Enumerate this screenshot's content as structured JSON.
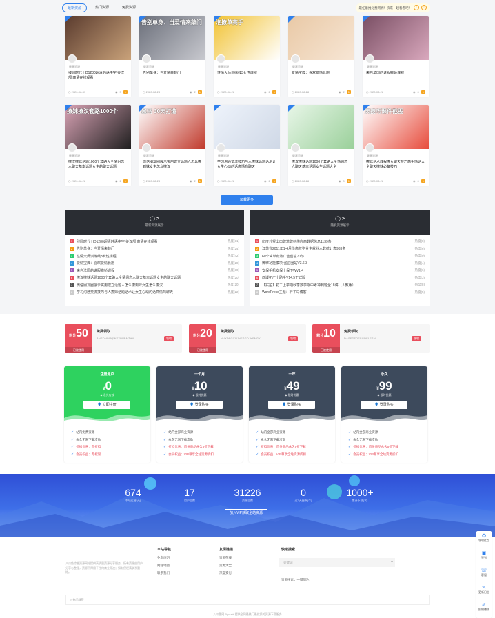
{
  "tabs": [
    "最新资源",
    "热门资源",
    "免费资源"
  ],
  "notice": "最任意推化费网拥！快来一起看看吧！",
  "cards": [
    {
      "title": "残圆时代 HD1280超清韩语中字 姜汉部 高清在线观看",
      "author": "健客资源",
      "date": "2020-08-31",
      "views": "3",
      "badge": "1",
      "thumb_label": "",
      "colors": [
        "#5a3b2e",
        "#c9a27a"
      ]
    },
    {
      "title": "告别单身：当爱情来敲门",
      "author": "健客资源",
      "date": "2020-08-28",
      "views": "2",
      "badge": "1",
      "thumb_label": "告别单身：当爱情来敲门",
      "colors": [
        "#6b6f7a",
        "#c8c9cf"
      ]
    },
    {
      "title": "性情大师训练线3女性课程",
      "author": "健客资源",
      "date": "2020-08-28",
      "views": "2",
      "badge": "1",
      "thumb_label": "泡撩单高手",
      "colors": [
        "#f1c232",
        "#ffffff"
      ]
    },
    {
      "title": "爱情宝典：喜欢爱情长跑",
      "author": "健客资源",
      "date": "2020-08-28",
      "views": "2",
      "badge": "1",
      "thumb_label": "",
      "colors": [
        "#e9c9a6",
        "#f7e6d5"
      ]
    },
    {
      "title": "来自法国的说服撒娇课程",
      "author": "健客资源",
      "date": "2020-08-28",
      "views": "0",
      "badge": "1",
      "thumb_label": "",
      "colors": [
        "#7a4f64",
        "#d9a8bd"
      ]
    },
    {
      "title": "撩汉撩妹话题1000个套路大全情侣恋人聊天基本话题女生的聊天话题",
      "author": "健客资源",
      "date": "2020-08-28",
      "views": "2",
      "badge": "1",
      "thumb_label": "撩妹撩汉套路1000个",
      "colors": [
        "#d9a3b5",
        "#1f1f1f"
      ]
    },
    {
      "title": "微信朋友圈展示实用建立话题人怎么撩到妹女生怎么撩汉",
      "author": "健客资源",
      "date": "2020-08-28",
      "views": "2",
      "badge": "1",
      "thumb_label": "黑马 30天打造",
      "colors": [
        "#ffffff",
        "#c0392b"
      ]
    },
    {
      "title": "学习沟通交流技巧与人撩妹话题话术让女生心动的话高情商聊天",
      "author": "健客资源",
      "date": "2020-08-28",
      "views": "2",
      "badge": "1",
      "thumb_label": "",
      "colors": [
        "#eef3fb",
        "#cfd8e6"
      ]
    },
    {
      "title": "撩汉撩妹话题1000个套路大全情侣恋人聊天基本话题女生话题大全",
      "author": "健客资源",
      "date": "2020-08-28",
      "views": "0",
      "badge": "1",
      "thumb_label": "",
      "colors": [
        "#e8f6e8",
        "#9ad09a"
      ]
    },
    {
      "title": "撩妹话术教程撩女聊天技巧高手情话大全聊天撩妹必备技巧",
      "author": "健客资源",
      "date": "2020-08-28",
      "views": "0",
      "badge": "1",
      "thumb_label": "天技巧课件截图",
      "colors": [
        "#ffffff",
        "#e74c3c"
      ]
    }
  ],
  "load_more": "加载更多",
  "rank_left": {
    "title": "热门资源",
    "subtitle": "最新资源展示",
    "items": [
      {
        "text": "残圆时代 HD1280超清韩语中字 姜汉部 高清在线观看",
        "hot": "热度(31)",
        "color": "#e94f5d"
      },
      {
        "text": "告别单身：当爱情来敲门",
        "hot": "热度(24)",
        "color": "#f39c12"
      },
      {
        "text": "性情大师训练线3女性课程",
        "hot": "热度(42)",
        "color": "#2ecc71"
      },
      {
        "text": "爱情宝典：喜欢爱情长跑",
        "hot": "热度(28)",
        "color": "#3498db"
      },
      {
        "text": "来自法国的说服撒娇课程",
        "hot": "热度(30)",
        "color": "#9b59b6"
      },
      {
        "text": "撩汉撩妹话题1000个套路大全情侣恋人聊天基本话题女生的聊天话题",
        "hot": "热度(20)",
        "color": "#e94f5d"
      },
      {
        "text": "微信朋友圈展示实用建立话题人怎么撩到妹女生怎么撩汉",
        "hot": "热度(20)",
        "color": "#555555"
      },
      {
        "text": "学习沟通交流技巧与人撩妹话题话术让女生心动的话高情商聊天",
        "hot": "热度(22)",
        "color": "#cccccc"
      }
    ]
  },
  "rank_right": {
    "title": "随机资源",
    "subtitle": "随机资源展示",
    "items": [
      {
        "text": "印度外贸出口建筑建材供应商数据信息1139条",
        "hot": "热度(8)",
        "color": "#e94f5d"
      },
      {
        "text": "江苏省2011年1-4月份高校毕业生就业人数统计表933条",
        "hot": "热度(6)",
        "color": "#f39c12"
      },
      {
        "text": "60个简单有效广告创意70节",
        "hot": "热度(0)",
        "color": "#2ecc71"
      },
      {
        "text": "微擎功能模块 强企圈站V3.6.3",
        "hot": "热度(4)",
        "color": "#3498db"
      },
      {
        "text": "安保手机安保上保卫WV1.4",
        "hot": "热度(6)",
        "color": "#9b59b6"
      },
      {
        "text": "西域拓广小助手V14.5正式版",
        "hot": "热度(3)",
        "color": "#e94f5d"
      },
      {
        "text": "【实拍】初二上学期秋季数学期中考冲刺班全18讲（人教版）",
        "hot": "热度(8)",
        "color": "#555555"
      },
      {
        "text": "WordPress主题：轩子马博客",
        "hot": "热度(5)",
        "color": "#cccccc"
      }
    ]
  },
  "coupons": [
    {
      "amount": "50",
      "unit": "积分",
      "status": "已被使用",
      "name": "免费领取",
      "code": "ANSDHWJQWSXBVBNZHY",
      "get": "领取"
    },
    {
      "amount": "20",
      "unit": "积分",
      "status": "已被使用",
      "name": "免费领取",
      "code": "NVXDFGYUJNFSGDJKFNGK",
      "get": "领取"
    },
    {
      "amount": "10",
      "unit": "积分",
      "status": "已被使用",
      "name": "免费领取",
      "code": "DASFDFDFSGDFLFSH",
      "get": "领取"
    }
  ],
  "plans": [
    {
      "name": "注册用户",
      "currency": "¥",
      "price": "0",
      "sub": "永久有效",
      "button": "立即注册",
      "features": [
        "站内免费资源",
        "永久无限下载次数",
        "折扣优惠：无折扣",
        "会员权益：无权限"
      ]
    },
    {
      "name": "一个月",
      "currency": "¥",
      "price": "10",
      "sub": "限时优惠",
      "button": "登录购买",
      "features": [
        "站内全部商业资源",
        "永久无限下载次数",
        "折扣优惠：首份商品永久5折下载",
        "会员权益：VIP尊享全站资源折扣"
      ]
    },
    {
      "name": "一年",
      "currency": "¥",
      "price": "49",
      "sub": "限时优惠",
      "button": "登录购买",
      "features": [
        "站内全部商业资源",
        "永久无限下载次数",
        "折扣优惠：首份商品永久5折下载",
        "会员权益：VIP尊享全站资源折扣"
      ]
    },
    {
      "name": "永久",
      "currency": "¥",
      "price": "99",
      "sub": "限时优惠",
      "button": "登录购买",
      "features": [
        "站内全部商业资源",
        "永久无限下载次数",
        "折扣优惠：首份商品永久5折下载",
        "会员权益：VIP尊享全站资源折扣"
      ]
    }
  ],
  "stats": [
    {
      "value": "674",
      "label": "本站运营(天)"
    },
    {
      "value": "17",
      "label": "用户总数"
    },
    {
      "value": "31226",
      "label": "资源总数"
    },
    {
      "value": "0",
      "label": "近7天更新(个)"
    },
    {
      "value": "1000+",
      "label": "累计下载(次)"
    }
  ],
  "join_button": "加入VIP获取全站资源",
  "footer": {
    "desc": "八爪鱼综合资源网站提供高质量资源分享服务，所有资源由用户分享与整理，资源不得用于任何商业用途；如有侵权请联系删除。",
    "nav_title": "本站导航",
    "nav": [
      "免责声明",
      "网站地图",
      "联系我们"
    ],
    "links_title": "友情链接",
    "links": [
      "资源在线",
      "资源大全",
      "深度支付"
    ],
    "search_title": "快速搜索",
    "search_placeholder": "关键词",
    "search_hint": "资源搜索，一键到达！",
    "tags_label": "热门标签",
    "copyright": "八爪鱼网 Byuuuk 提供全网最热门最优质的资源下载服务"
  },
  "side_toolbar": [
    "领取红包",
    "签到",
    "客服",
    "更新日志",
    "投稿赚钱"
  ]
}
